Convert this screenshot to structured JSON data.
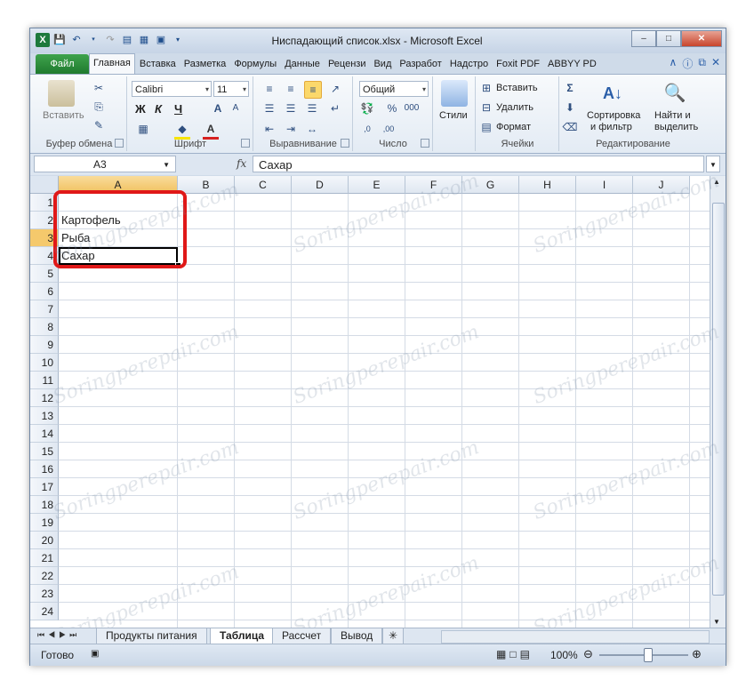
{
  "titlebar": {
    "title": "Ниспадающий список.xlsx - Microsoft Excel"
  },
  "tabs": {
    "file": "Файл",
    "items": [
      "Главная",
      "Вставка",
      "Разметка",
      "Формулы",
      "Данные",
      "Рецензи",
      "Вид",
      "Разработ",
      "Надстро",
      "Foxit PDF",
      "ABBYY PD"
    ]
  },
  "ribbon": {
    "clipboard": {
      "paste": "Вставить",
      "label": "Буфер обмена"
    },
    "font": {
      "name": "Calibri",
      "size": "11",
      "bold": "Ж",
      "italic": "К",
      "underline": "Ч",
      "label": "Шрифт"
    },
    "alignment": {
      "label": "Выравнивание"
    },
    "number": {
      "format": "Общий",
      "label": "Число"
    },
    "styles": {
      "label": "Стили"
    },
    "cells": {
      "insert": "Вставить",
      "delete": "Удалить",
      "format": "Формат",
      "label": "Ячейки"
    },
    "editing": {
      "sort": "Сортировка",
      "sort2": "и фильтр",
      "find": "Найти и",
      "find2": "выделить",
      "label": "Редактирование"
    }
  },
  "formula_bar": {
    "name_box": "A3",
    "fx": "fx",
    "value": "Сахар"
  },
  "grid": {
    "columns": [
      "A",
      "B",
      "C",
      "D",
      "E",
      "F",
      "G",
      "H",
      "I",
      "J"
    ],
    "rows": [
      "1",
      "2",
      "3",
      "4",
      "5",
      "6",
      "7",
      "8",
      "9",
      "10",
      "11",
      "12",
      "13",
      "14",
      "15",
      "16",
      "17",
      "18",
      "19",
      "20",
      "21",
      "22",
      "23",
      "24"
    ],
    "cells": {
      "A1": "Картофель",
      "A2": "Рыба",
      "A3": "Сахар"
    },
    "selected_cell": "A3"
  },
  "sheets": {
    "tabs": [
      "Продукты питания",
      "Таблица",
      "Рассчет",
      "Вывод"
    ],
    "active": "Таблица"
  },
  "status": {
    "ready": "Готово",
    "zoom": "100%"
  },
  "watermark": "Soringperepair.com"
}
